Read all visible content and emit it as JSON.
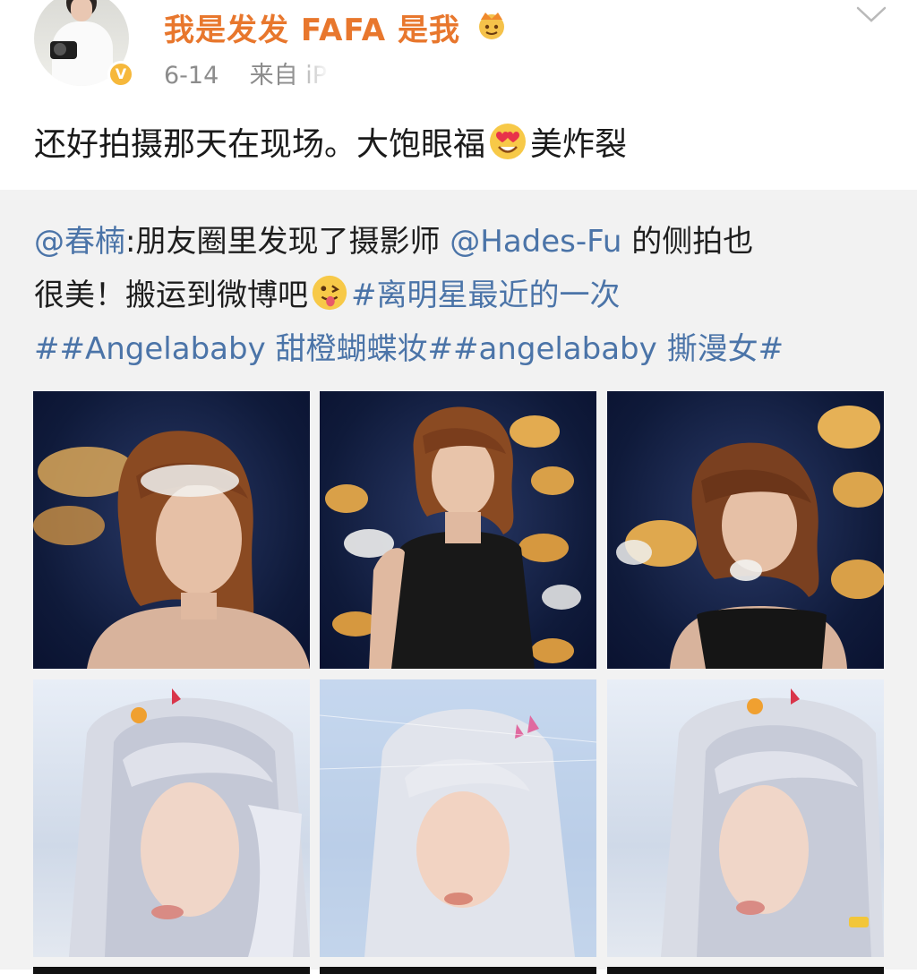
{
  "user": {
    "name": "我是发发 FAFA 是我",
    "badge_icon": "crown-icon",
    "verified_icon": "verified-v-icon",
    "verified_color": "#f6b83b",
    "name_color": "#e8772d"
  },
  "meta": {
    "date": "6-14",
    "source_prefix": "来自",
    "source": "iP"
  },
  "post": {
    "text_before_emoji": "还好拍摄那天在现场。大饱眼福",
    "emoji": "heart-eyes-emoji",
    "text_after_emoji": "美炸裂"
  },
  "repost": {
    "mention_author": "@春楠",
    "colon": ":",
    "text_1": "朋友圈里发现了摄影师 ",
    "mention_photographer": "@Hades-Fu",
    "text_2": "  的侧拍也",
    "text_3": "很美！搬运到微博吧",
    "emoji": "tongue-out-emoji",
    "hashtag_1": "#离明星最近的一次",
    "hashtag_2": "##Angelababy 甜橙蝴蝶妆#",
    "hashtag_3": "#angelababy 撕漫女#",
    "link_color": "#4b74a8"
  },
  "images": [
    {
      "name": "photo-1",
      "theme": "dark-butterflies"
    },
    {
      "name": "photo-2",
      "theme": "dark-butterflies"
    },
    {
      "name": "photo-3",
      "theme": "dark-butterflies"
    },
    {
      "name": "photo-4",
      "theme": "silver-hair"
    },
    {
      "name": "photo-5",
      "theme": "silver-hair"
    },
    {
      "name": "photo-6",
      "theme": "silver-hair"
    }
  ]
}
